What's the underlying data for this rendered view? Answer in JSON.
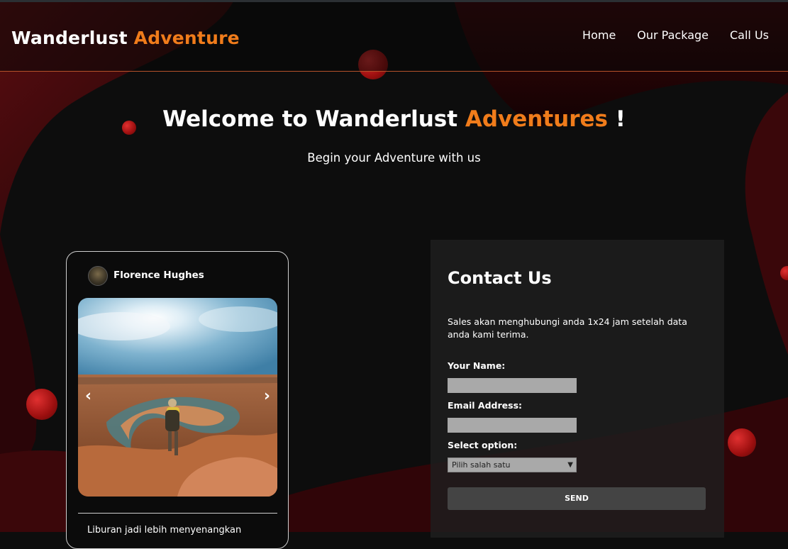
{
  "header": {
    "brand_main": "Wanderlust",
    "brand_accent": "Adventure",
    "nav": [
      "Home",
      "Our Package",
      "Call Us"
    ]
  },
  "hero": {
    "title_main": "Welcome to Wanderlust",
    "title_accent": "Adventures",
    "title_end": "!",
    "subtitle": "Begin your Adventure with us"
  },
  "card": {
    "username": "Florence Hughes",
    "prev_icon": "‹",
    "next_icon": "›",
    "caption": "Liburan jadi lebih menyenangkan"
  },
  "contact": {
    "title": "Contact Us",
    "description": "Sales akan menghubungi anda 1x24 jam setelah data anda kami terima.",
    "name_label": "Your Name:",
    "email_label": "Email Address:",
    "select_label": "Select option:",
    "select_value": "Pilih salah satu",
    "send_label": "SEND"
  },
  "colors": {
    "accent": "#f07c1b",
    "background": "#0d0d0d",
    "orb": "#c41e1e"
  }
}
